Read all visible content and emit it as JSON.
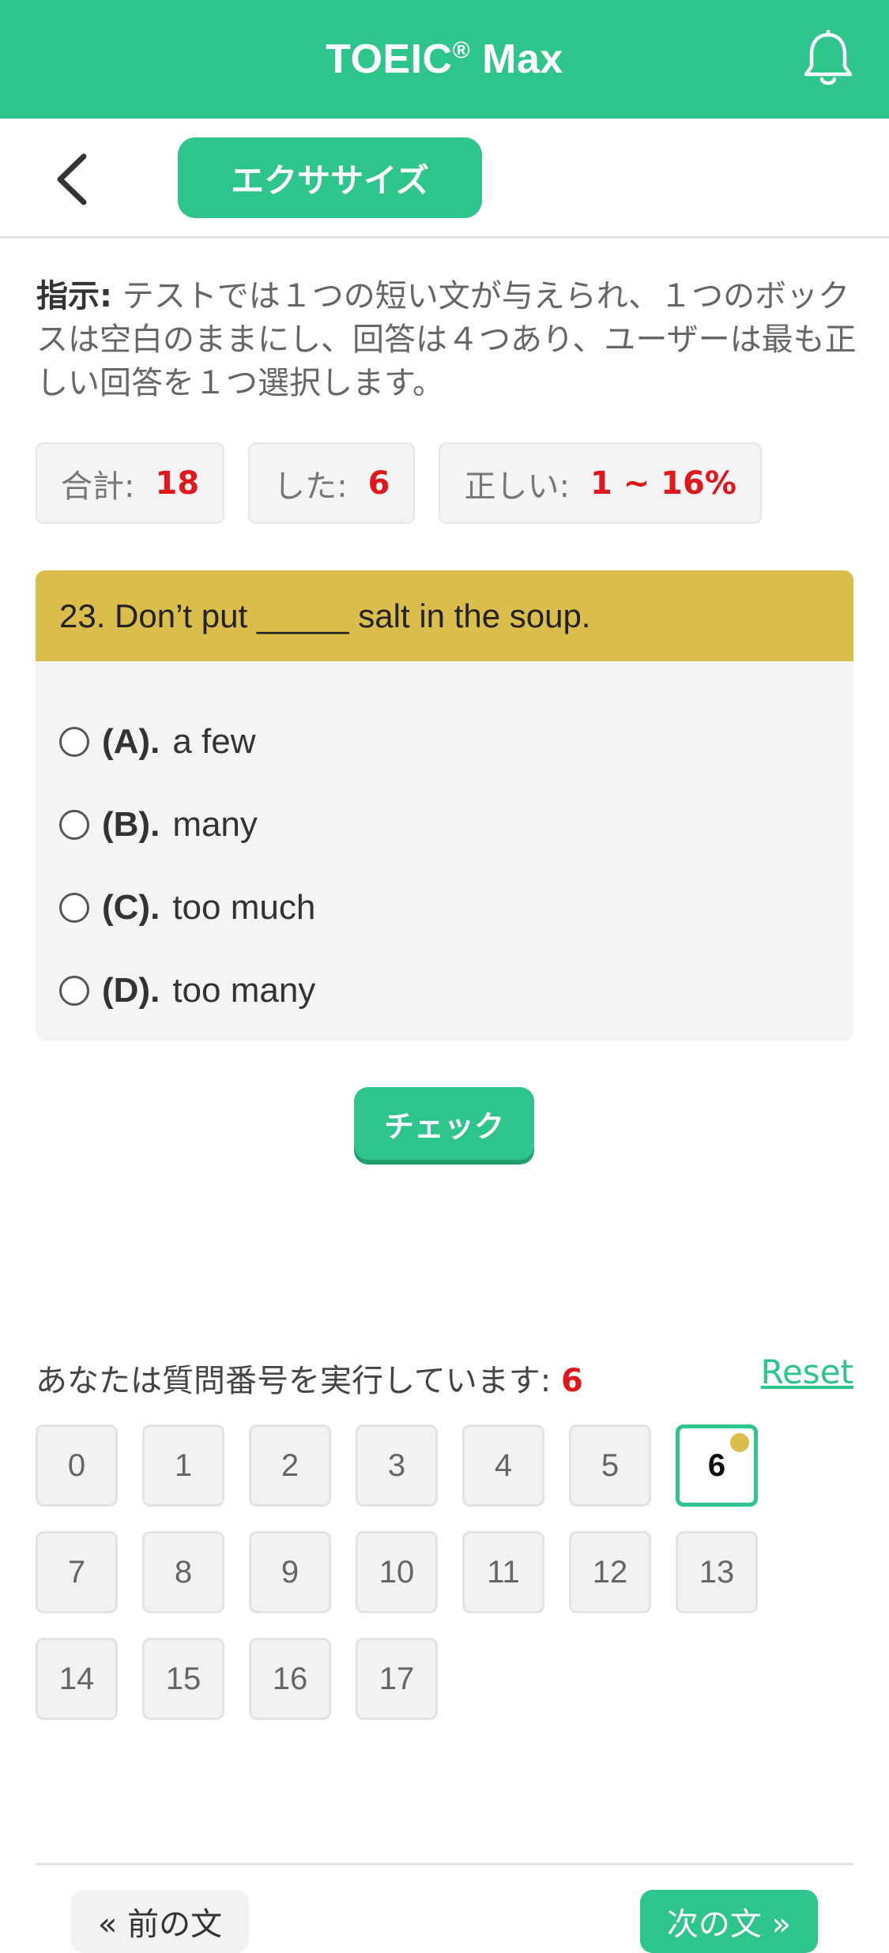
{
  "header": {
    "title_main": "TOEIC",
    "title_reg": "®",
    "title_tail": " Max",
    "bell_icon": "bell-icon"
  },
  "subbar": {
    "back_icon": "chevron-left-icon",
    "tab_label": "エクササイズ"
  },
  "instructions": {
    "label": "指示:",
    "text": " テストでは１つの短い文が与えられ、１つのボックスは空白のままにし、回答は４つあり、ユーザーは最も正しい回答を１つ選択します。"
  },
  "stats": {
    "total_label": "合計:",
    "total_value": "18",
    "done_label": "した:",
    "done_value": "6",
    "correct_label": "正しい:",
    "correct_value": "1 ~ 16%"
  },
  "question": {
    "text": "23. Don’t put _____ salt in the soup.",
    "options": [
      {
        "letter": "(A).",
        "text": "a few"
      },
      {
        "letter": "(B).",
        "text": "many"
      },
      {
        "letter": "(C).",
        "text": "too much"
      },
      {
        "letter": "(D).",
        "text": "too many"
      }
    ]
  },
  "check_label": "チェック",
  "progress": {
    "text": "あなたは質問番号を実行しています:",
    "current": "6",
    "reset_label": "Reset",
    "numbers": [
      "0",
      "1",
      "2",
      "3",
      "4",
      "5",
      "6",
      "7",
      "8",
      "9",
      "10",
      "11",
      "12",
      "13",
      "14",
      "15",
      "16",
      "17"
    ]
  },
  "nav": {
    "prev_label": "« 前の文",
    "next_label": "次の文 »"
  },
  "colors": {
    "brand": "#2dc58b",
    "question_header": "#dbbd4c",
    "accent_red": "#e0181b"
  }
}
